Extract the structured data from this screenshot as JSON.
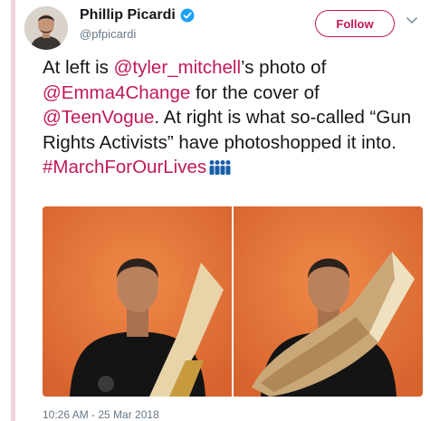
{
  "author": {
    "display_name": "Phillip Picardi",
    "handle": "@pfpicardi",
    "verified": true
  },
  "follow_button": {
    "label": "Follow"
  },
  "tweet": {
    "t1": "At left is ",
    "m1": "@tyler_mitchell",
    "t2": "’s photo of ",
    "m2": "@Emma4Change",
    "t3": " for the cover of ",
    "m3": "@TeenVogue",
    "t4": ". At right is what so-called “Gun Rights Activists” have photoshopped it into.",
    "hashtag": "#MarchForOurLives",
    "emoji": "group-of-people-emoji"
  },
  "media": [
    {
      "kind": "photo",
      "subject": "person-holding-paper-target"
    },
    {
      "kind": "photo",
      "subject": "person-tearing-paper"
    }
  ],
  "timestamp": "10:26 AM - 25 Mar 2018",
  "colors": {
    "accent": "#c2185b",
    "thread_line": "#f0d4dc",
    "photo_background": "#e2713a",
    "muted_text": "#657786"
  }
}
